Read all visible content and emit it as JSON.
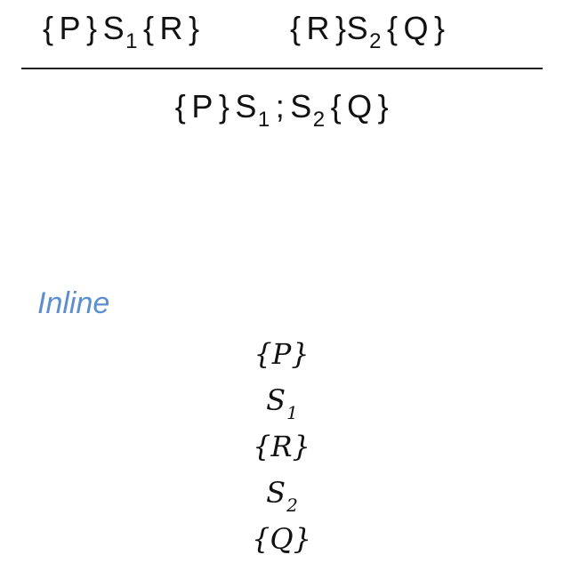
{
  "rule": {
    "premise_left": {
      "pre": "P",
      "stmt": "S",
      "stmt_sub": "1",
      "post": "R"
    },
    "premise_right": {
      "pre": "R",
      "stmt": "S",
      "stmt_sub": "2",
      "post": "Q"
    },
    "conclusion": {
      "pre": "P",
      "stmt1": "S",
      "stmt1_sub": "1",
      "separator": ";",
      "stmt2": "S",
      "stmt2_sub": "2",
      "post": "Q"
    },
    "brace_open": "{",
    "brace_close": "}"
  },
  "inline": {
    "heading": "Inline",
    "lines": [
      {
        "text": "{P}",
        "sub": ""
      },
      {
        "text": "S",
        "sub": "1"
      },
      {
        "text": "{R}",
        "sub": ""
      },
      {
        "text": "S",
        "sub": "2"
      },
      {
        "text": "{Q}",
        "sub": ""
      }
    ]
  }
}
